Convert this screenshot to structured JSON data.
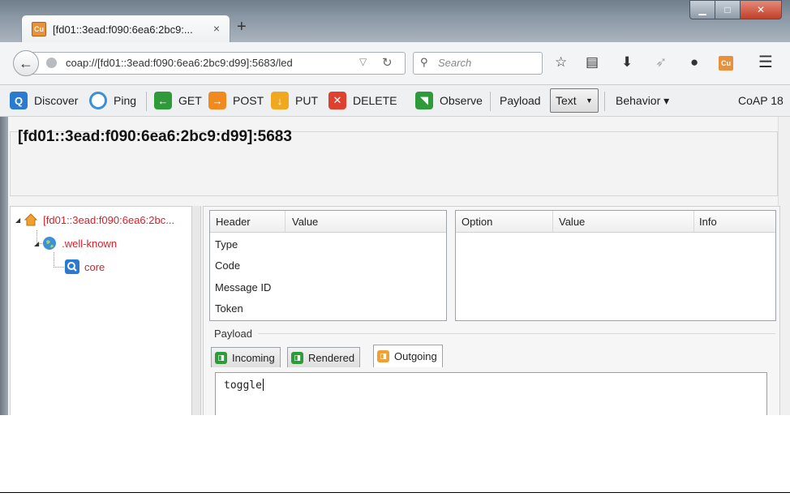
{
  "browser": {
    "tab_title": "[fd01::3ead:f090:6ea6:2bc9:...",
    "tab_close": "×",
    "new_tab": "+",
    "url": "coap://[fd01::3ead:f090:6ea6:2bc9:d99]:5683/led",
    "search_placeholder": "Search",
    "window_controls": {
      "minimize": "▁",
      "maximize": "□",
      "close": "✕"
    },
    "favicon_text": "Cu"
  },
  "toolbar": {
    "discover": "Discover",
    "ping": "Ping",
    "get": "GET",
    "post": "POST",
    "put": "PUT",
    "delete": "DELETE",
    "observe": "Observe",
    "payload": "Payload",
    "payload_format": "Text",
    "behavior": "Behavior ▾",
    "version": "CoAP 18"
  },
  "host_title": "[fd01::3ead:f090:6ea6:2bc9:d99]:5683",
  "tree": {
    "root": "[fd01::3ead:f090:6ea6:2bc...",
    "wellknown": ".well-known",
    "core": "core"
  },
  "header_table": {
    "columns": [
      "Header",
      "Value"
    ],
    "rows": [
      "Type",
      "Code",
      "Message ID",
      "Token"
    ]
  },
  "options_table": {
    "columns": [
      "Option",
      "Value",
      "Info"
    ]
  },
  "payload": {
    "label": "Payload",
    "tabs": [
      "Incoming",
      "Rendered",
      "Outgoing"
    ],
    "active_tab": "Outgoing",
    "text": "toggle"
  },
  "colors": {
    "discover": "#2a7bd0",
    "get": "#2e9a3a",
    "post": "#f08a1e",
    "put": "#f0a81e",
    "delete": "#e0412f",
    "observe": "#2f9a3a",
    "tree_text": "#d6212b"
  },
  "icons": [
    "back-arrow-icon",
    "globe-icon",
    "dropdown-icon",
    "reload-icon",
    "search-icon",
    "star-icon",
    "reading-list-icon",
    "download-icon",
    "share-icon",
    "chat-icon",
    "copper-icon",
    "menu-icon",
    "home-icon",
    "globe-icon",
    "magnifier-icon"
  ]
}
